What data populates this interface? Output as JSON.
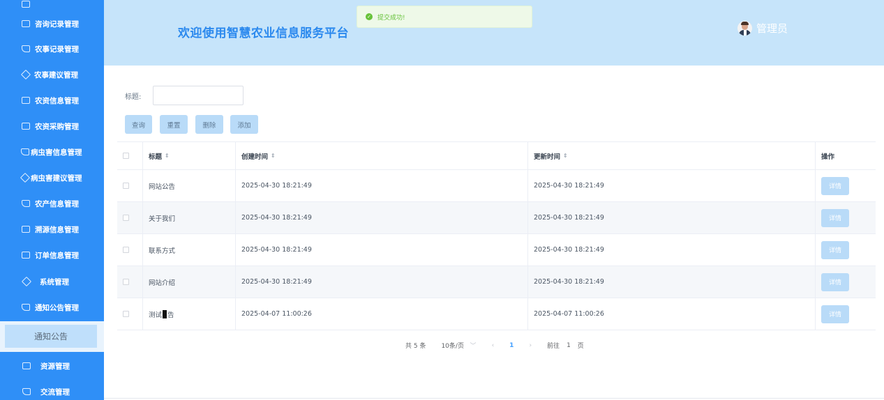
{
  "sidebar": {
    "items": [
      {
        "label": "咨询记录管理",
        "icon": "chart-icon"
      },
      {
        "label": "农事记录管理",
        "icon": "edit-icon"
      },
      {
        "label": "农事建议管理",
        "icon": "diamond-icon"
      },
      {
        "label": "农资信息管理",
        "icon": "chart-icon"
      },
      {
        "label": "农资采购管理",
        "icon": "list-icon"
      },
      {
        "label": "病虫害信息管理",
        "icon": "edit-icon"
      },
      {
        "label": "病虫害建议管理",
        "icon": "diamond-icon"
      },
      {
        "label": "农产信息管理",
        "icon": "edit-icon"
      },
      {
        "label": "溯源信息管理",
        "icon": "list-icon"
      },
      {
        "label": "订单信息管理",
        "icon": "chart-icon"
      },
      {
        "label": "系统管理",
        "icon": "diamond-icon"
      },
      {
        "label": "通知公告管理",
        "icon": "edit-icon"
      }
    ],
    "active_sub": "通知公告",
    "bottom_items": [
      {
        "label": "资源管理",
        "icon": "chart-icon"
      },
      {
        "label": "交流管理",
        "icon": "edit-icon"
      }
    ]
  },
  "header": {
    "title": "欢迎使用智慧农业信息服务平台",
    "toast": "提交成功!",
    "user": "管理员"
  },
  "search": {
    "label": "标题:",
    "value": ""
  },
  "buttons": {
    "query": "查询",
    "reset": "重置",
    "delete": "删除",
    "add": "添加"
  },
  "table": {
    "columns": [
      "标题",
      "创建时间",
      "更新时间",
      "操作"
    ],
    "rows": [
      {
        "title": "网站公告",
        "created": "2025-04-30 18:21:49",
        "updated": "2025-04-30 18:21:49"
      },
      {
        "title": "关于我们",
        "created": "2025-04-30 18:21:49",
        "updated": "2025-04-30 18:21:49"
      },
      {
        "title": "联系方式",
        "created": "2025-04-30 18:21:49",
        "updated": "2025-04-30 18:21:49"
      },
      {
        "title": "网站介绍",
        "created": "2025-04-30 18:21:49",
        "updated": "2025-04-30 18:21:49"
      },
      {
        "title_a": "测试",
        "title_b": "告",
        "created": "2025-04-07 11:00:26",
        "updated": "2025-04-07 11:00:26"
      }
    ],
    "action_label": "详情"
  },
  "pagination": {
    "total": "共 5 条",
    "page_size": "10条/页",
    "current": "1",
    "goto_prefix": "前往",
    "goto_value": "1",
    "goto_suffix": "页"
  }
}
